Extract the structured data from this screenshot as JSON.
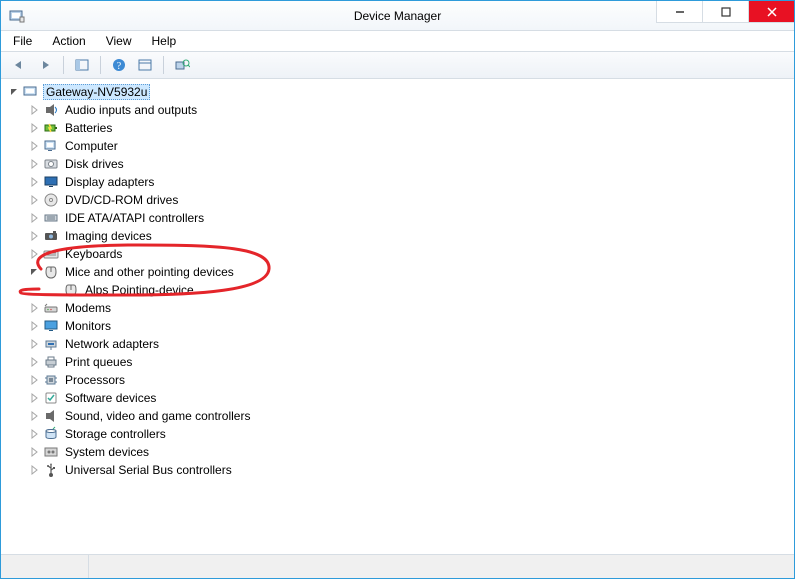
{
  "window": {
    "title": "Device Manager"
  },
  "menu": {
    "file": "File",
    "action": "Action",
    "view": "View",
    "help": "Help"
  },
  "toolbar": {
    "back": "Back",
    "forward": "Forward",
    "show_hide_console": "Show/Hide Console Tree",
    "help_btn": "Help",
    "properties": "Properties",
    "scan": "Scan for hardware changes"
  },
  "tree": {
    "root": "Gateway-NV5932u",
    "items": [
      {
        "label": "Audio inputs and outputs",
        "icon": "audio"
      },
      {
        "label": "Batteries",
        "icon": "battery"
      },
      {
        "label": "Computer",
        "icon": "computer"
      },
      {
        "label": "Disk drives",
        "icon": "disk"
      },
      {
        "label": "Display adapters",
        "icon": "display"
      },
      {
        "label": "DVD/CD-ROM drives",
        "icon": "dvd"
      },
      {
        "label": "IDE ATA/ATAPI controllers",
        "icon": "ide"
      },
      {
        "label": "Imaging devices",
        "icon": "imaging"
      },
      {
        "label": "Keyboards",
        "icon": "keyboard"
      },
      {
        "label": "Mice and other pointing devices",
        "icon": "mouse",
        "expanded": true,
        "children": [
          {
            "label": "Alps Pointing-device",
            "icon": "mouse"
          }
        ]
      },
      {
        "label": "Modems",
        "icon": "modem"
      },
      {
        "label": "Monitors",
        "icon": "monitor"
      },
      {
        "label": "Network adapters",
        "icon": "network"
      },
      {
        "label": "Print queues",
        "icon": "printer"
      },
      {
        "label": "Processors",
        "icon": "cpu"
      },
      {
        "label": "Software devices",
        "icon": "software"
      },
      {
        "label": "Sound, video and game controllers",
        "icon": "sound"
      },
      {
        "label": "Storage controllers",
        "icon": "storage"
      },
      {
        "label": "System devices",
        "icon": "system"
      },
      {
        "label": "Universal Serial Bus controllers",
        "icon": "usb"
      }
    ]
  }
}
